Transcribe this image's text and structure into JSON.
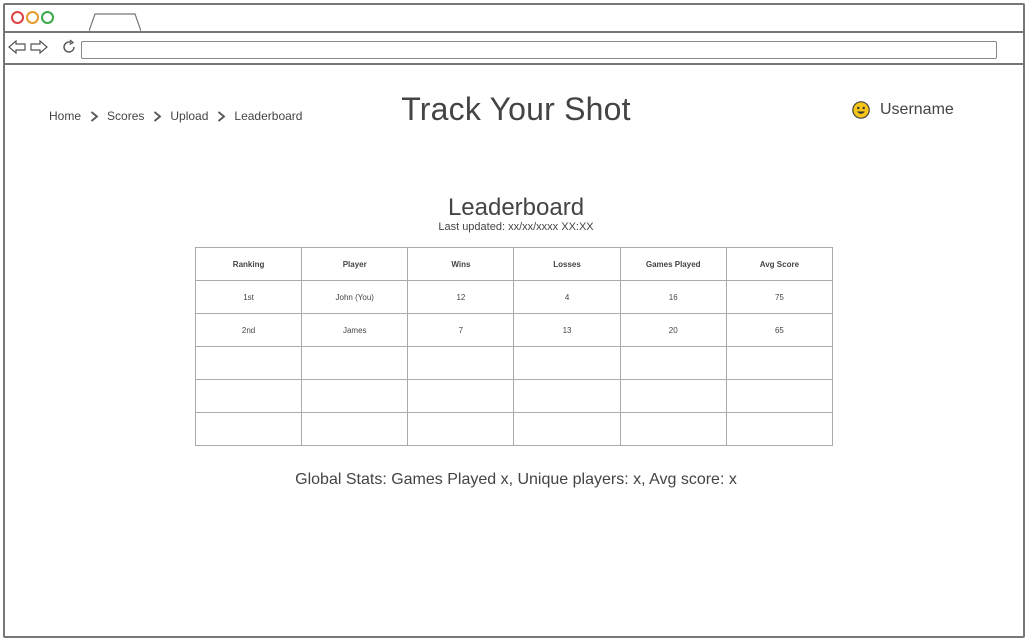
{
  "breadcrumb": {
    "items": [
      "Home",
      "Scores",
      "Upload",
      "Leaderboard"
    ]
  },
  "site_title": "Track Your Shot",
  "user": {
    "name": "Username",
    "avatar_icon": "smiley-icon"
  },
  "leaderboard": {
    "title": "Leaderboard",
    "last_updated": "Last updated: xx/xx/xxxx XX:XX",
    "columns": [
      "Ranking",
      "Player",
      "Wins",
      "Losses",
      "Games Played",
      "Avg Score"
    ],
    "rows": [
      [
        "1st",
        "John (You)",
        "12",
        "4",
        "16",
        "75"
      ],
      [
        "2nd",
        "James",
        "7",
        "13",
        "20",
        "65"
      ],
      [
        "",
        "",
        "",
        "",
        "",
        ""
      ],
      [
        "",
        "",
        "",
        "",
        "",
        ""
      ],
      [
        "",
        "",
        "",
        "",
        "",
        ""
      ]
    ]
  },
  "global_stats": "Global Stats: Games Played x, Unique players: x, Avg score: x",
  "colors": {
    "window_border": "#777777",
    "close": "#e04141",
    "minimize": "#e59a2b",
    "maximize": "#3aa94a"
  }
}
